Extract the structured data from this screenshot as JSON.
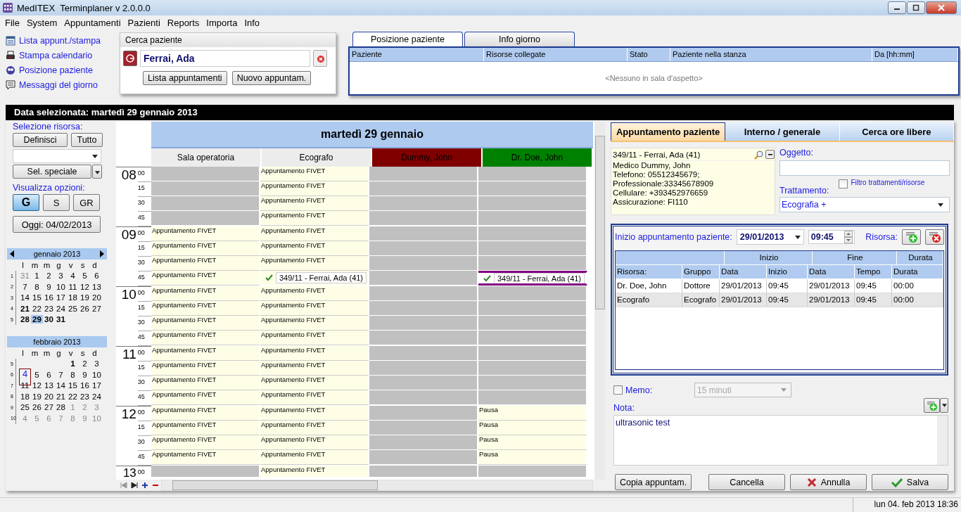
{
  "window": {
    "title": "MedITEX  Terminplaner v 2.0.0.0"
  },
  "menu": [
    "File",
    "System",
    "Appuntamenti",
    "Pazienti",
    "Reports",
    "Importa",
    "Info"
  ],
  "quick_links": [
    {
      "label": "Lista appunt./stampa",
      "kind": "list"
    },
    {
      "label": "Stampa calendario",
      "kind": "print"
    },
    {
      "label": "Posizione paziente",
      "kind": "position"
    },
    {
      "label": "Messaggi del giorno",
      "kind": "message"
    }
  ],
  "patient_search": {
    "title": "Cerca paziente",
    "value": "Ferrai, Ada",
    "buttons": [
      "Lista appuntamenti",
      "Nuovo appuntam."
    ]
  },
  "waiting_room": {
    "tabs": [
      {
        "label": "Posizione paziente",
        "selected": true
      },
      {
        "label": "Info giorno",
        "selected": false
      }
    ],
    "columns": [
      "Paziente",
      "Risorse collegate",
      "Stato",
      "Paziente nella stanza",
      "Da [hh:mm]"
    ],
    "empty_text": "<Nessuno in sala d'aspetto>"
  },
  "date_bar": "Data selezionata: martedì 29 gennaio 2013",
  "resource_panel": {
    "selection_label": "Selezione risorsa:",
    "define_button": "Definisci",
    "all_button": "Tutto",
    "special_button": "Sel. speciale",
    "view_label": "Visualizza opzioni:",
    "views": [
      {
        "label": "G",
        "selected": true
      },
      {
        "label": "S",
        "selected": false
      },
      {
        "label": "GR",
        "selected": false
      }
    ],
    "today_button": "Oggi: 04/02/2013"
  },
  "mini_calendars": [
    {
      "title": "gennaio 2013",
      "arrows": true,
      "weekdays": [
        "l",
        "m",
        "m",
        "g",
        "v",
        "s",
        "d"
      ],
      "weeks": [
        {
          "number": "1",
          "days": [
            {
              "day": "31",
              "kind": "other"
            },
            {
              "day": "1",
              "kind": "normal"
            },
            {
              "day": "2",
              "kind": "normal"
            },
            {
              "day": "3",
              "kind": "normal"
            },
            {
              "day": "4",
              "kind": "normal"
            },
            {
              "day": "5",
              "kind": "normal"
            },
            {
              "day": "6",
              "kind": "normal"
            }
          ]
        },
        {
          "number": "2",
          "days": [
            {
              "day": "7",
              "kind": "normal"
            },
            {
              "day": "8",
              "kind": "normal"
            },
            {
              "day": "9",
              "kind": "normal"
            },
            {
              "day": "10",
              "kind": "normal"
            },
            {
              "day": "11",
              "kind": "normal"
            },
            {
              "day": "12",
              "kind": "normal"
            },
            {
              "day": "13",
              "kind": "normal"
            }
          ]
        },
        {
          "number": "3",
          "days": [
            {
              "day": "14",
              "kind": "normal"
            },
            {
              "day": "15",
              "kind": "normal"
            },
            {
              "day": "16",
              "kind": "normal"
            },
            {
              "day": "17",
              "kind": "normal"
            },
            {
              "day": "18",
              "kind": "normal"
            },
            {
              "day": "19",
              "kind": "normal"
            },
            {
              "day": "20",
              "kind": "normal"
            }
          ]
        },
        {
          "number": "4",
          "days": [
            {
              "day": "21",
              "kind": "bold"
            },
            {
              "day": "22",
              "kind": "normal"
            },
            {
              "day": "23",
              "kind": "normal"
            },
            {
              "day": "24",
              "kind": "normal"
            },
            {
              "day": "25",
              "kind": "normal"
            },
            {
              "day": "26",
              "kind": "normal"
            },
            {
              "day": "27",
              "kind": "normal"
            }
          ]
        },
        {
          "number": "5",
          "days": [
            {
              "day": "28",
              "kind": "bold"
            },
            {
              "day": "29",
              "kind": "selected"
            },
            {
              "day": "30",
              "kind": "bold"
            },
            {
              "day": "31",
              "kind": "bold"
            }
          ]
        }
      ]
    },
    {
      "title": "febbraio 2013",
      "arrows": false,
      "weekdays": [
        "l",
        "m",
        "m",
        "g",
        "v",
        "s",
        "d"
      ],
      "weeks": [
        {
          "number": "5",
          "days": [
            {
              "kind": "blank"
            },
            {
              "kind": "blank"
            },
            {
              "kind": "blank"
            },
            {
              "kind": "blank"
            },
            {
              "day": "1",
              "kind": "bold"
            },
            {
              "day": "2",
              "kind": "normal"
            },
            {
              "day": "3",
              "kind": "normal"
            }
          ]
        },
        {
          "number": "6",
          "days": [
            {
              "day": "4",
              "kind": "today"
            },
            {
              "day": "5",
              "kind": "normal"
            },
            {
              "day": "6",
              "kind": "normal"
            },
            {
              "day": "7",
              "kind": "normal"
            },
            {
              "day": "8",
              "kind": "normal"
            },
            {
              "day": "9",
              "kind": "normal"
            },
            {
              "day": "10",
              "kind": "normal"
            }
          ]
        },
        {
          "number": "7",
          "days": [
            {
              "day": "11",
              "kind": "normal"
            },
            {
              "day": "12",
              "kind": "normal"
            },
            {
              "day": "13",
              "kind": "normal"
            },
            {
              "day": "14",
              "kind": "normal"
            },
            {
              "day": "15",
              "kind": "normal"
            },
            {
              "day": "16",
              "kind": "normal"
            },
            {
              "day": "17",
              "kind": "normal"
            }
          ]
        },
        {
          "number": "8",
          "days": [
            {
              "day": "18",
              "kind": "normal"
            },
            {
              "day": "19",
              "kind": "normal"
            },
            {
              "day": "20",
              "kind": "normal"
            },
            {
              "day": "21",
              "kind": "normal"
            },
            {
              "day": "22",
              "kind": "normal"
            },
            {
              "day": "23",
              "kind": "normal"
            },
            {
              "day": "24",
              "kind": "normal"
            }
          ]
        },
        {
          "number": "9",
          "days": [
            {
              "day": "25",
              "kind": "normal"
            },
            {
              "day": "26",
              "kind": "normal"
            },
            {
              "day": "27",
              "kind": "normal"
            },
            {
              "day": "28",
              "kind": "normal"
            },
            {
              "day": "1",
              "kind": "other"
            },
            {
              "day": "2",
              "kind": "other"
            },
            {
              "day": "3",
              "kind": "other"
            }
          ]
        },
        {
          "number": "10",
          "days": [
            {
              "day": "4",
              "kind": "other"
            },
            {
              "day": "5",
              "kind": "other"
            },
            {
              "day": "6",
              "kind": "other"
            },
            {
              "day": "7",
              "kind": "other"
            },
            {
              "day": "8",
              "kind": "other"
            },
            {
              "day": "9",
              "kind": "other"
            },
            {
              "day": "10",
              "kind": "other"
            }
          ]
        }
      ]
    }
  ],
  "schedule": {
    "day_title": "martedì 29 gennaio",
    "resources": [
      {
        "name": "Sala operatoria",
        "color": "#ececec"
      },
      {
        "name": "Ecografo",
        "color": "#ececec"
      },
      {
        "name": "Dummy, John",
        "color": "#800000"
      },
      {
        "name": "Dr. Doe, John",
        "color": "#008000"
      }
    ],
    "hours": [
      {
        "hour": "08",
        "slots": [
          {
            "minute": "00",
            "cells": [
              {
                "kind": "free"
              },
              {
                "kind": "block",
                "text": "Appuntamento FIVET"
              },
              {
                "kind": "free"
              },
              {
                "kind": "free"
              }
            ]
          },
          {
            "minute": "15",
            "cells": [
              {
                "kind": "free"
              },
              {
                "kind": "block",
                "text": "Appuntamento FIVET"
              },
              {
                "kind": "free"
              },
              {
                "kind": "free"
              }
            ]
          },
          {
            "minute": "30",
            "cells": [
              {
                "kind": "free"
              },
              {
                "kind": "block",
                "text": "Appuntamento FIVET"
              },
              {
                "kind": "free"
              },
              {
                "kind": "free"
              }
            ]
          },
          {
            "minute": "45",
            "cells": [
              {
                "kind": "free"
              },
              {
                "kind": "block",
                "text": "Appuntamento FIVET"
              },
              {
                "kind": "free"
              },
              {
                "kind": "free"
              }
            ]
          }
        ]
      },
      {
        "hour": "09",
        "slots": [
          {
            "minute": "00",
            "cells": [
              {
                "kind": "block",
                "text": "Appuntamento FIVET"
              },
              {
                "kind": "block",
                "text": "Appuntamento FIVET"
              },
              {
                "kind": "free"
              },
              {
                "kind": "free"
              }
            ]
          },
          {
            "minute": "15",
            "cells": [
              {
                "kind": "block",
                "text": "Appuntamento FIVET"
              },
              {
                "kind": "block",
                "text": "Appuntamento FIVET"
              },
              {
                "kind": "free"
              },
              {
                "kind": "free"
              }
            ]
          },
          {
            "minute": "30",
            "cells": [
              {
                "kind": "block",
                "text": "Appuntamento FIVET"
              },
              {
                "kind": "block",
                "text": "Appuntamento FIVET"
              },
              {
                "kind": "free"
              },
              {
                "kind": "free"
              }
            ]
          },
          {
            "minute": "45",
            "cells": [
              {
                "kind": "block",
                "text": "Appuntamento FIVET"
              },
              {
                "kind": "appointment",
                "text": "349/11 - Ferrai, Ada (41)",
                "highlighted": false
              },
              {
                "kind": "free"
              },
              {
                "kind": "appointment",
                "text": "349/11 - Ferrai, Ada (41)",
                "highlighted": true
              }
            ]
          }
        ]
      },
      {
        "hour": "10",
        "slots": [
          {
            "minute": "00",
            "cells": [
              {
                "kind": "block",
                "text": "Appuntamento FIVET"
              },
              {
                "kind": "block",
                "text": "Appuntamento FIVET"
              },
              {
                "kind": "free"
              },
              {
                "kind": "free"
              }
            ]
          },
          {
            "minute": "15",
            "cells": [
              {
                "kind": "block",
                "text": "Appuntamento FIVET"
              },
              {
                "kind": "block",
                "text": "Appuntamento FIVET"
              },
              {
                "kind": "free"
              },
              {
                "kind": "free"
              }
            ]
          },
          {
            "minute": "30",
            "cells": [
              {
                "kind": "block",
                "text": "Appuntamento FIVET"
              },
              {
                "kind": "block",
                "text": "Appuntamento FIVET"
              },
              {
                "kind": "free"
              },
              {
                "kind": "free"
              }
            ]
          },
          {
            "minute": "45",
            "cells": [
              {
                "kind": "block",
                "text": "Appuntamento FIVET"
              },
              {
                "kind": "block",
                "text": "Appuntamento FIVET"
              },
              {
                "kind": "free"
              },
              {
                "kind": "free"
              }
            ]
          }
        ]
      },
      {
        "hour": "11",
        "slots": [
          {
            "minute": "00",
            "cells": [
              {
                "kind": "block",
                "text": "Appuntamento FIVET"
              },
              {
                "kind": "block",
                "text": "Appuntamento FIVET"
              },
              {
                "kind": "free"
              },
              {
                "kind": "free"
              }
            ]
          },
          {
            "minute": "15",
            "cells": [
              {
                "kind": "block",
                "text": "Appuntamento FIVET"
              },
              {
                "kind": "block",
                "text": "Appuntamento FIVET"
              },
              {
                "kind": "free"
              },
              {
                "kind": "free"
              }
            ]
          },
          {
            "minute": "30",
            "cells": [
              {
                "kind": "block",
                "text": "Appuntamento FIVET"
              },
              {
                "kind": "block",
                "text": "Appuntamento FIVET"
              },
              {
                "kind": "free"
              },
              {
                "kind": "free"
              }
            ]
          },
          {
            "minute": "45",
            "cells": [
              {
                "kind": "block",
                "text": "Appuntamento FIVET"
              },
              {
                "kind": "block",
                "text": "Appuntamento FIVET"
              },
              {
                "kind": "free"
              },
              {
                "kind": "free"
              }
            ]
          }
        ]
      },
      {
        "hour": "12",
        "slots": [
          {
            "minute": "00",
            "cells": [
              {
                "kind": "block",
                "text": "Appuntamento FIVET"
              },
              {
                "kind": "block",
                "text": "Appuntamento FIVET"
              },
              {
                "kind": "free"
              },
              {
                "kind": "block",
                "text": "Pausa"
              }
            ]
          },
          {
            "minute": "15",
            "cells": [
              {
                "kind": "block",
                "text": "Appuntamento FIVET"
              },
              {
                "kind": "block",
                "text": "Appuntamento FIVET"
              },
              {
                "kind": "free"
              },
              {
                "kind": "block",
                "text": "Pausa"
              }
            ]
          },
          {
            "minute": "30",
            "cells": [
              {
                "kind": "block",
                "text": "Appuntamento FIVET"
              },
              {
                "kind": "block",
                "text": "Appuntamento FIVET"
              },
              {
                "kind": "free"
              },
              {
                "kind": "block",
                "text": "Pausa"
              }
            ]
          },
          {
            "minute": "45",
            "cells": [
              {
                "kind": "block",
                "text": "Appuntamento FIVET"
              },
              {
                "kind": "block",
                "text": "Appuntamento FIVET"
              },
              {
                "kind": "free"
              },
              {
                "kind": "block",
                "text": "Pausa"
              }
            ]
          }
        ]
      },
      {
        "hour": "13",
        "slots": [
          {
            "minute": "00",
            "cells": [
              {
                "kind": "free"
              },
              {
                "kind": "block",
                "text": "Appuntamento FIVET"
              },
              {
                "kind": "free"
              },
              {
                "kind": "free"
              }
            ]
          }
        ]
      }
    ]
  },
  "appointment_form": {
    "tabs": [
      {
        "label": "Appuntamento paziente",
        "selected": true
      },
      {
        "label": "Interno / generale",
        "selected": false
      },
      {
        "label": "Cerca ore libere",
        "selected": false
      }
    ],
    "patient": {
      "header": "349/11 - Ferrai, Ada (41)",
      "details": [
        "Medico Dummy, John",
        "Telefono:  05512345679;",
        "Professionale:33345678909",
        "Cellulare: +393452976659",
        "Assicurazione: FI110"
      ]
    },
    "subject_label": "Oggetto:",
    "filter": {
      "label": "Filtro trattamenti/risorse",
      "checked": false
    },
    "treatment_label": "Trattamento:",
    "treatment": "Ecografia +",
    "start_label": "Inizio appuntamento paziente:",
    "start_date": "29/01/2013",
    "start_time": "09:45",
    "resource_label": "Risorsa:",
    "table": {
      "groups": [
        "Inizio",
        "Fine",
        "Durata"
      ],
      "columns": [
        "Risorsa:",
        "Gruppo",
        "Data",
        "Inizio",
        "Data",
        "Tempo",
        "Durata"
      ],
      "rows": [
        {
          "cells": [
            "Dr. Doe, John",
            "Dottore",
            "29/01/2013",
            "09:45",
            "29/01/2013",
            "09:45",
            "00:00"
          ],
          "selected": false
        },
        {
          "cells": [
            "Ecografo",
            "Ecografo",
            "29/01/2013",
            "09:45",
            "29/01/2013",
            "09:45",
            "00:00"
          ],
          "selected": true
        }
      ]
    },
    "memo": {
      "label": "Memo:",
      "checked": false,
      "interval": "15 minuti"
    },
    "note_label": "Nota:",
    "note": "ultrasonic test",
    "buttons": [
      {
        "label": "Copia appuntam.",
        "kind": "plain"
      },
      {
        "label": "Cancella",
        "kind": "plain"
      },
      {
        "label": "Annulla",
        "kind": "cancel"
      },
      {
        "label": "Salva",
        "kind": "save"
      }
    ]
  },
  "status_bar": {
    "datetime": "lun 04. feb 2013 18:36"
  }
}
